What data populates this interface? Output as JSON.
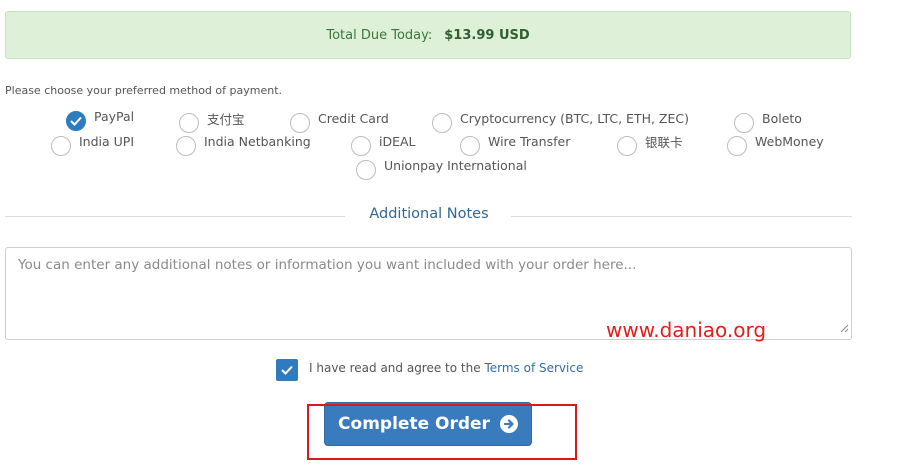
{
  "total": {
    "label": "Total Due Today:",
    "amount": "$13.99 USD"
  },
  "payment": {
    "prompt": "Please choose your preferred method of payment.",
    "methods": [
      {
        "label": "PayPal",
        "checked": true
      },
      {
        "label": "支付宝",
        "checked": false
      },
      {
        "label": "Credit Card",
        "checked": false
      },
      {
        "label": "Cryptocurrency (BTC, LTC, ETH, ZEC)",
        "checked": false
      },
      {
        "label": "Boleto",
        "checked": false
      },
      {
        "label": "India UPI",
        "checked": false
      },
      {
        "label": "India Netbanking",
        "checked": false
      },
      {
        "label": "iDEAL",
        "checked": false
      },
      {
        "label": "Wire Transfer",
        "checked": false
      },
      {
        "label": "银联卡",
        "checked": false
      },
      {
        "label": "WebMoney",
        "checked": false
      },
      {
        "label": "Unionpay International",
        "checked": false
      }
    ]
  },
  "notes": {
    "title": "Additional Notes",
    "placeholder": "You can enter any additional notes or information you want included with your order here..."
  },
  "tos": {
    "checked": true,
    "text": "I have read and agree to the",
    "link": "Terms of Service"
  },
  "complete_button": {
    "label": "Complete Order"
  },
  "watermark": "www.daniao.org",
  "colors": {
    "accent": "#2f7bbf",
    "success_bg": "#dff0d8",
    "highlight_frame": "#d7191c"
  }
}
